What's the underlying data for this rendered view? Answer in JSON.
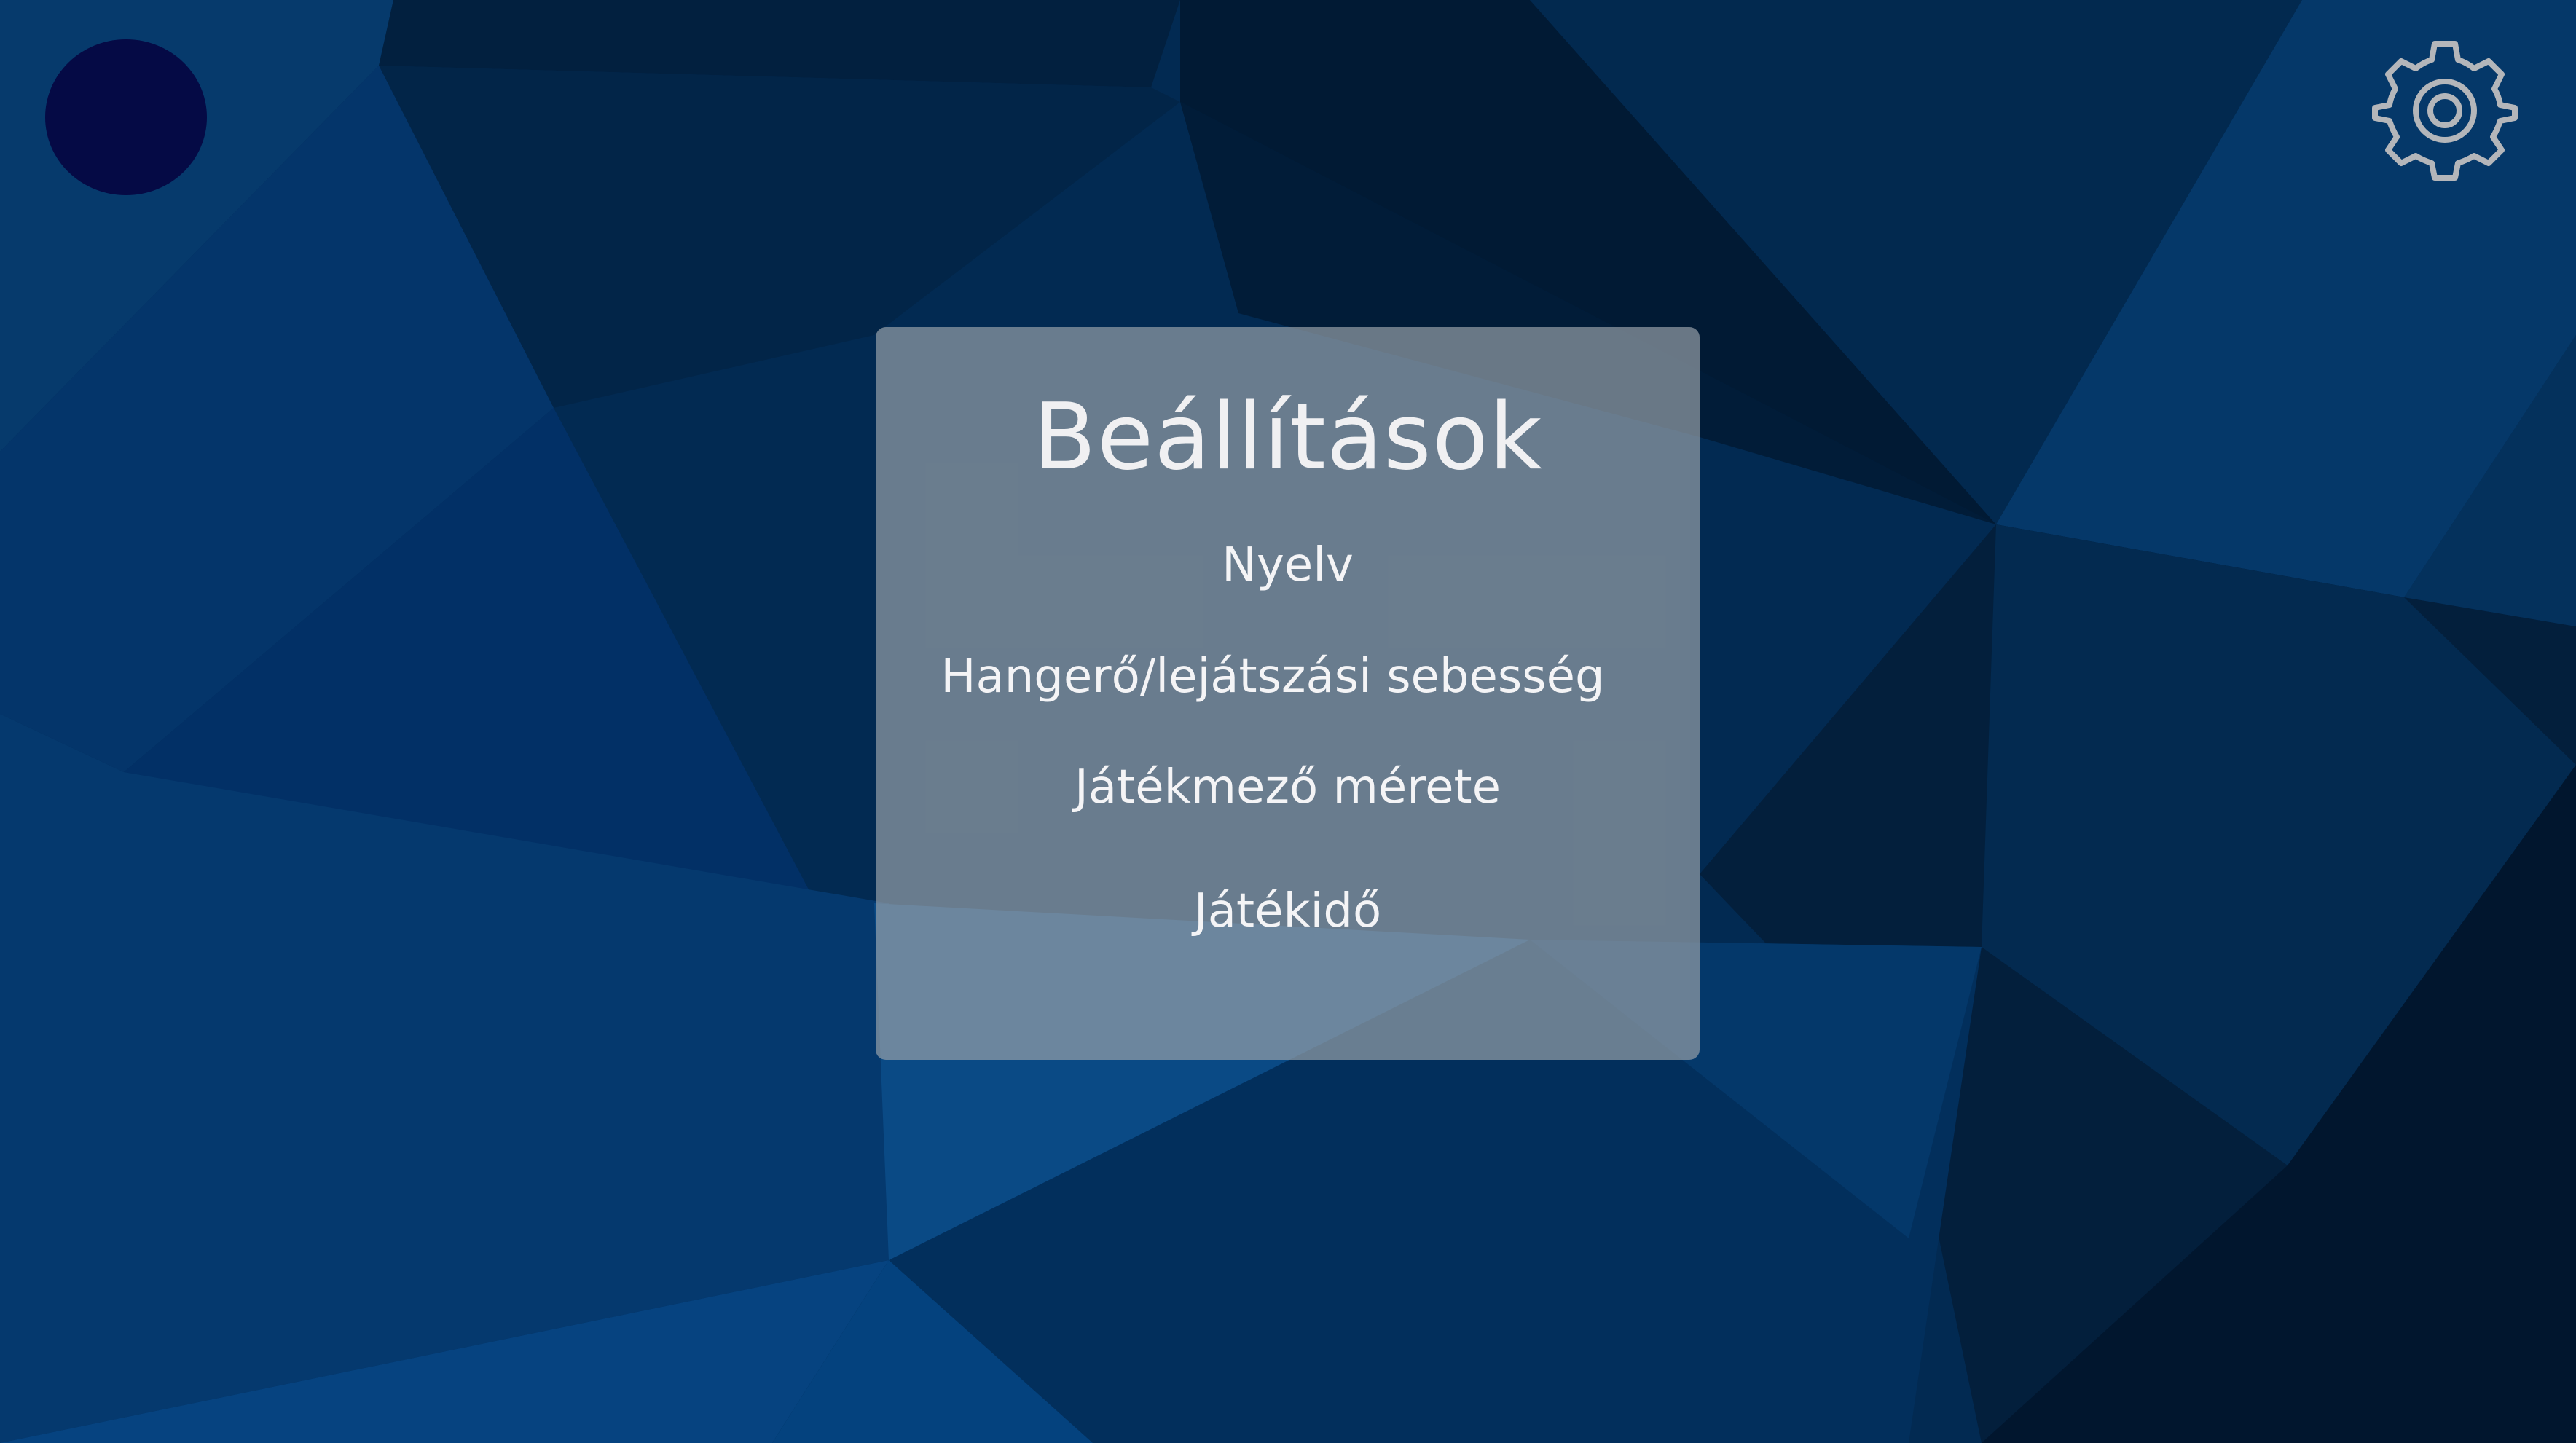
{
  "colors": {
    "background_base": "#022a52",
    "avatar_fill": "#050a45",
    "panel_fill": "rgba(150,160,168,0.70)",
    "text": "#f4f4f6",
    "settings_icon_stroke": "#b4b6ba"
  },
  "icons": {
    "avatar": "avatar-circle",
    "settings": "gear-icon"
  },
  "settings_panel": {
    "title": "Beállítások",
    "items": [
      {
        "label": "Nyelv"
      },
      {
        "label": "Hangerő/lejátszási sebesség"
      },
      {
        "label": "Játékmező mérete"
      },
      {
        "label": "Játékidő"
      }
    ]
  }
}
